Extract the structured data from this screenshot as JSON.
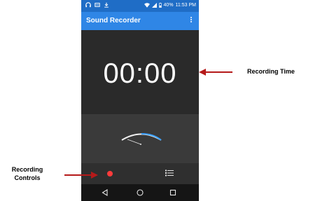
{
  "status_bar": {
    "battery_percent": "40%",
    "time": "11:53 PM",
    "icons": [
      "headphones-icon",
      "notification-icon",
      "download-icon",
      "wifi-icon",
      "signal-icon",
      "battery-icon"
    ]
  },
  "app_bar": {
    "title": "Sound Recorder",
    "menu_icon": "overflow-menu-icon"
  },
  "timer": {
    "value": "00:00"
  },
  "controls": {
    "record_icon": "record-icon",
    "list_icon": "list-icon"
  },
  "nav_bar": {
    "icons": [
      "back-icon",
      "home-icon",
      "recents-icon"
    ]
  },
  "annotations": {
    "recording_time": "Recording Time",
    "recording_controls_line1": "Recording",
    "recording_controls_line2": "Controls"
  },
  "colors": {
    "app_bar": "#2f86e6",
    "status_bar": "#1f6dc6",
    "record": "#ff3b3b",
    "arrow": "#b51a1a",
    "gauge_arc": "#3aa0ff"
  }
}
